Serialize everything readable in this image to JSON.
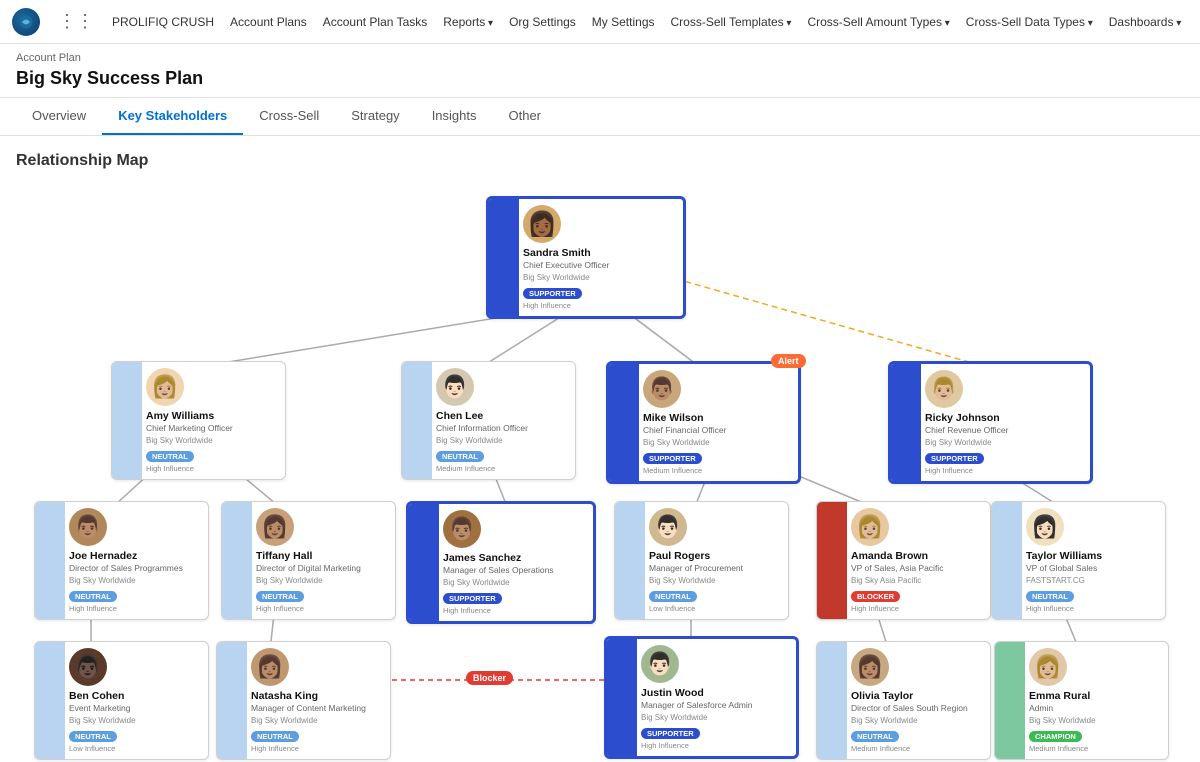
{
  "nav": {
    "links": [
      "PROLIFIQ CRUSH",
      "Account Plans",
      "Account Plan Tasks",
      "Reports",
      "Org Settings",
      "My Settings",
      "Cross-Sell Templates",
      "Cross-Sell Amount Types",
      "Cross-Sell Data Types",
      "Dashboards"
    ]
  },
  "breadcrumb": "Account Plan",
  "pageTitle": "Big Sky Success Plan",
  "tabs": [
    "Overview",
    "Key Stakeholders",
    "Cross-Sell",
    "Strategy",
    "Insights",
    "Other"
  ],
  "activeTab": "Key Stakeholders",
  "sectionTitle": "Relationship Map",
  "people": {
    "sandra": {
      "name": "Sandra Smith",
      "title": "Chief Executive Officer",
      "company": "Big Sky Worldwide",
      "badge": "SUPPORTER",
      "badgeType": "supporter",
      "influence": "High Influence",
      "color": "blue",
      "highlighted": true,
      "avatar": "👩🏾"
    },
    "amy": {
      "name": "Amy Williams",
      "title": "Chief Marketing Officer",
      "company": "Big Sky Worldwide",
      "badge": "NEUTRAL",
      "badgeType": "neutral",
      "influence": "High Influence",
      "color": "light-blue",
      "highlighted": false,
      "avatar": "👩🏼"
    },
    "chen": {
      "name": "Chen Lee",
      "title": "Chief Information Officer",
      "company": "Big Sky Worldwide",
      "badge": "NEUTRAL",
      "badgeType": "neutral",
      "influence": "Medium Influence",
      "color": "light-blue",
      "highlighted": false,
      "avatar": "👨🏻"
    },
    "mike": {
      "name": "Mike Wilson",
      "title": "Chief Financial Officer",
      "company": "Big Sky Worldwide",
      "badge": "SUPPORTER",
      "badgeType": "supporter",
      "influence": "Medium Influence",
      "color": "blue",
      "highlighted": true,
      "avatar": "👨🏽"
    },
    "ricky": {
      "name": "Ricky Johnson",
      "title": "Chief Revenue Officer",
      "company": "Big Sky Worldwide",
      "badge": "SUPPORTER",
      "badgeType": "supporter",
      "influence": "High Influence",
      "color": "blue",
      "highlighted": true,
      "avatar": "👨🏼"
    },
    "joe": {
      "name": "Joe Hernadez",
      "title": "Director of Sales Programmes",
      "company": "Big Sky Worldwide",
      "badge": "NEUTRAL",
      "badgeType": "neutral",
      "influence": "High Influence",
      "color": "light-blue",
      "highlighted": false,
      "avatar": "👨🏽"
    },
    "tiffany": {
      "name": "Tiffany Hall",
      "title": "Director of Digital Marketing",
      "company": "Big Sky Worldwide",
      "badge": "NEUTRAL",
      "badgeType": "neutral",
      "influence": "High Influence",
      "color": "light-blue",
      "highlighted": false,
      "avatar": "👩🏽"
    },
    "james": {
      "name": "James Sanchez",
      "title": "Manager of Sales Operations",
      "company": "Big Sky Worldwide",
      "badge": "SUPPORTER",
      "badgeType": "supporter",
      "influence": "High Influence",
      "color": "blue",
      "highlighted": true,
      "avatar": "👨🏽"
    },
    "paul": {
      "name": "Paul Rogers",
      "title": "Manager of Procurement",
      "company": "Big Sky Worldwide",
      "badge": "NEUTRAL",
      "badgeType": "neutral",
      "influence": "Low Influence",
      "color": "light-blue",
      "highlighted": false,
      "avatar": "👨🏻"
    },
    "amanda": {
      "name": "Amanda Brown",
      "title": "VP of Sales, Asia Pacific",
      "company": "Big Sky Asia Pacific",
      "badge": "BLOCKER",
      "badgeType": "blocker",
      "influence": "High Influence",
      "color": "red",
      "highlighted": false,
      "avatar": "👩🏼"
    },
    "taylor": {
      "name": "Taylor Williams",
      "title": "VP of Global Sales",
      "company": "FASTSTART.CG",
      "badge": "NEUTRAL",
      "badgeType": "neutral",
      "influence": "High Influence",
      "color": "light-blue",
      "highlighted": false,
      "avatar": "👩🏻"
    },
    "ben": {
      "name": "Ben Cohen",
      "title": "Event Marketing",
      "company": "Big Sky Worldwide",
      "badge": "NEUTRAL",
      "badgeType": "neutral",
      "influence": "Low Influence",
      "color": "light-blue",
      "highlighted": false,
      "avatar": "👨🏿"
    },
    "natasha": {
      "name": "Natasha King",
      "title": "Manager of Content Marketing",
      "company": "Big Sky Worldwide",
      "badge": "NEUTRAL",
      "badgeType": "neutral",
      "influence": "High Influence",
      "color": "light-blue",
      "highlighted": false,
      "avatar": "👩🏽"
    },
    "justin": {
      "name": "Justin Wood",
      "title": "Manager of Salesforce Admin",
      "company": "Big Sky Worldwide",
      "badge": "SUPPORTER",
      "badgeType": "supporter",
      "influence": "High Influence",
      "color": "blue",
      "highlighted": true,
      "avatar": "👨🏻"
    },
    "olivia": {
      "name": "Olivia Taylor",
      "title": "Director of Sales South Region",
      "company": "Big Sky Worldwide",
      "badge": "NEUTRAL",
      "badgeType": "neutral",
      "influence": "Medium Influence",
      "color": "light-blue",
      "highlighted": false,
      "avatar": "👩🏽"
    },
    "emma": {
      "name": "Emma Rural",
      "title": "Admin",
      "company": "Big Sky Worldwide",
      "badge": "CHAMPION",
      "badgeType": "champion",
      "influence": "Medium Influence",
      "color": "green",
      "highlighted": false,
      "avatar": "👩🏼"
    }
  }
}
